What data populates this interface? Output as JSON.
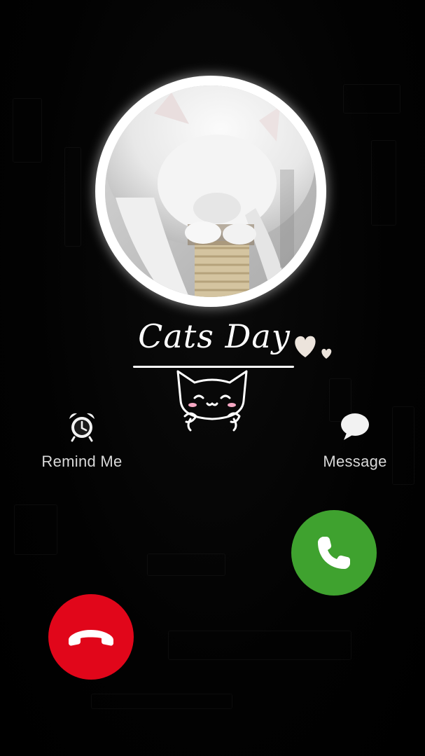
{
  "caller": {
    "name": "Cats Day",
    "photo": "white-kitten-photo"
  },
  "actions": {
    "remind": {
      "label": "Remind Me",
      "icon": "alarm-clock-icon"
    },
    "message": {
      "label": "Message",
      "icon": "speech-bubble-icon"
    }
  },
  "call_buttons": {
    "accept": {
      "icon": "phone-icon",
      "color": "#3fa22f"
    },
    "decline": {
      "icon": "phone-hangup-icon",
      "color": "#e1061a"
    }
  },
  "decorations": {
    "hearts": "hearts-icon",
    "cat": "cat-doodle-icon"
  }
}
